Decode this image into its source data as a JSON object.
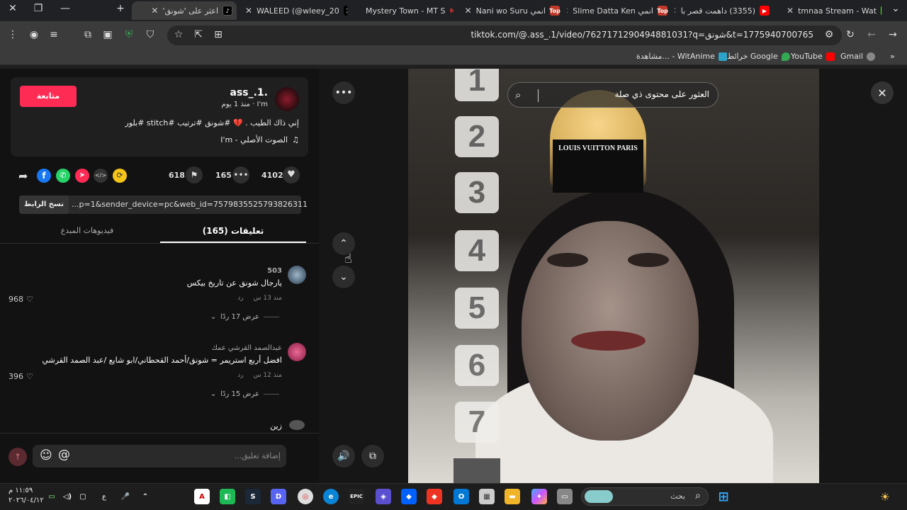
{
  "browser": {
    "tabs": [
      {
        "title": "اعثر على 'شونق'",
        "active": true,
        "icon": "tiktok-icon"
      },
      {
        "title": "WALEED (@wleey_20",
        "icon": "x-icon"
      },
      {
        "title": "Mystery Town - MT S",
        "icon": "mt-icon"
      },
      {
        "title": "انمي Nani wo Suru",
        "icon": "top-icon"
      },
      {
        "title": "انمي Slime Datta Ken",
        "icon": "top-icon"
      },
      {
        "title": "(3355) داهمت قصر با",
        "icon": "youtube-icon"
      },
      {
        "title": "tmnaa Stream - Wat",
        "icon": "kick-icon"
      }
    ],
    "url": "tiktok.com/@.ass_.1/video/7627171290494881031?q=شونق&t=1775940700765",
    "bookmarks": [
      {
        "label": "مشاهدة... - WitAnime",
        "color": "#2da3c9"
      },
      {
        "label": "خرائط Google",
        "color": "#34a853"
      },
      {
        "label": "YouTube",
        "color": "#ff0000"
      },
      {
        "label": "Gmail",
        "color": "#888888"
      }
    ]
  },
  "post": {
    "username": "ass_.1.",
    "meta": "I'm · منذ 1 يوم",
    "follow_label": "متابعة",
    "caption": "إني ذاك الطيب . 💔 #شونق #ترتيب #stitch #بلور",
    "sound": "الصوت الأصلي - I'm",
    "likes": "4102",
    "comments_count": "165",
    "saves": "618",
    "link_value": "...p=1&sender_device=pc&web_id=7579835525793826311",
    "copy_link_label": "نسخ الرابط",
    "tab_comments": "تعليقات (165)",
    "tab_creator": "فيديوهات المبدع"
  },
  "comments": [
    {
      "user": "503",
      "text": "يارجال شونق عن تاريخ بيكس",
      "meta": "منذ 13 س",
      "reply": "رد",
      "likes": "968",
      "view_replies": "عرض 17 ردًا"
    },
    {
      "user": "عبدالصمد القرشي عمك",
      "text": "افضل أربع استريمر = شونق/أحمد القحطاني/ابو شايع /عبد الصمد القرشي",
      "meta": "منذ 12 س",
      "reply": "رد",
      "likes": "396",
      "view_replies": "عرض 15 ردًا"
    },
    {
      "user": "",
      "text": "زين",
      "meta": "",
      "reply": "",
      "likes": "",
      "view_replies": ""
    }
  ],
  "comment_input": {
    "placeholder": "إضافة تعليق..."
  },
  "search": {
    "placeholder": "العثور على محتوى ذي صلة"
  },
  "video": {
    "tiles": [
      "1",
      "2",
      "3",
      "4",
      "5",
      "6",
      "7"
    ],
    "shirt_text": "LOUIS VUITTON PARIS"
  },
  "taskbar": {
    "time": "١١:٥٩ م",
    "date": "٢٠٢٦/٠٤/١٢",
    "search_label": "بحث",
    "lang": "ع"
  }
}
